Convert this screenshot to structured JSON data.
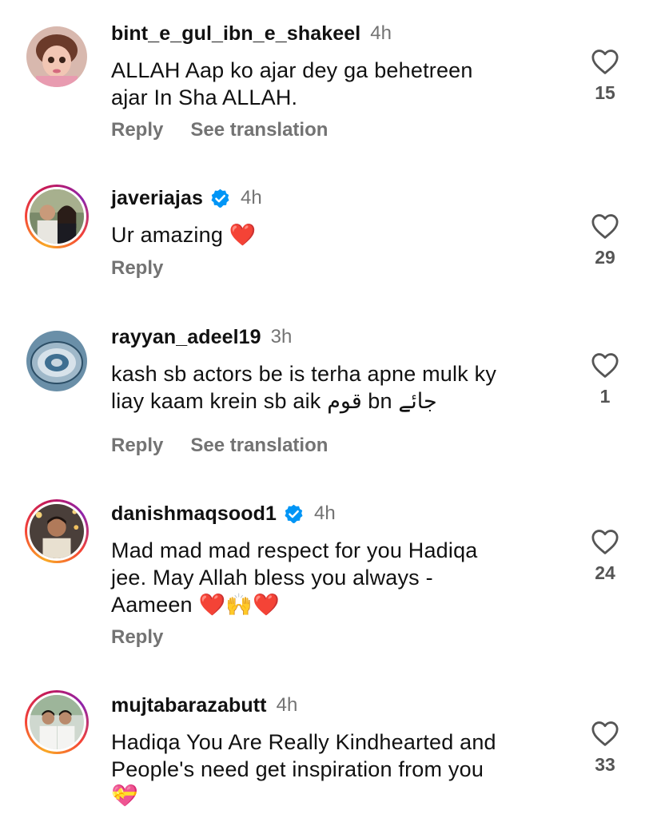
{
  "comments": [
    {
      "username": "bint_e_gul_ibn_e_shakeel",
      "time": "4h",
      "verified": false,
      "text_lines": [
        "ALLAH Aap ko ajar dey ga behetreen",
        "ajar In Sha ALLAH."
      ],
      "likes": "15",
      "reply": "Reply",
      "translate": "See translation"
    },
    {
      "username": "javeriajas",
      "time": "4h",
      "verified": true,
      "text_lines": [
        "Ur amazing ❤️"
      ],
      "likes": "29",
      "reply": "Reply"
    },
    {
      "username": "rayyan_adeel19",
      "time": "3h",
      "verified": false,
      "text_lines": [
        "kash sb actors be is terha apne mulk ky",
        "liay kaam krein sb aik قوم bn جائے"
      ],
      "likes": "1",
      "reply": "Reply",
      "translate": "See translation"
    },
    {
      "username": "danishmaqsood1",
      "time": "4h",
      "verified": true,
      "text_lines": [
        "Mad mad mad respect for you Hadiqa",
        "jee. May Allah bless you always -",
        "Aameen ❤️🙌❤️"
      ],
      "likes": "24",
      "reply": "Reply"
    },
    {
      "username": "mujtabarazabutt",
      "time": "4h",
      "verified": false,
      "text_lines": [
        "Hadiqa You Are Really Kindhearted and",
        "People's need get inspiration from you",
        "💝"
      ],
      "likes": "33"
    }
  ],
  "colors": {
    "text": "#111111",
    "secondary": "#737373",
    "verified": "#0095f6"
  },
  "icons": {
    "like": "heart-outline-icon",
    "verified": "verified-badge-icon"
  }
}
